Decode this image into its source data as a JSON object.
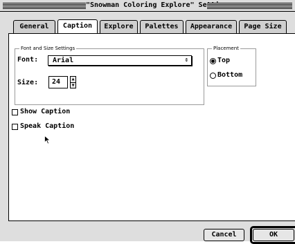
{
  "window": {
    "title": "\"Snowman Coloring Explore\" Settings"
  },
  "tabs": [
    {
      "label": "General"
    },
    {
      "label": "Caption"
    },
    {
      "label": "Explore"
    },
    {
      "label": "Palettes"
    },
    {
      "label": "Appearance"
    },
    {
      "label": "Page Size"
    }
  ],
  "active_tab": "Caption",
  "font_group": {
    "title": "Font and Size Settings",
    "font_label": "Font:",
    "font_value": "Arial",
    "size_label": "Size:",
    "size_value": "24"
  },
  "placement": {
    "title": "Placement",
    "options": [
      {
        "label": "Top",
        "selected": true
      },
      {
        "label": "Bottom",
        "selected": false
      }
    ]
  },
  "checkboxes": [
    {
      "label": "Show Caption",
      "checked": false
    },
    {
      "label": "Speak Caption",
      "checked": false
    }
  ],
  "buttons": {
    "cancel": "Cancel",
    "ok": "OK"
  },
  "icons": {
    "popup_arrows": "⇕",
    "stepper_up": "▲",
    "stepper_down": "▼",
    "cursor": "arrow-cursor"
  }
}
